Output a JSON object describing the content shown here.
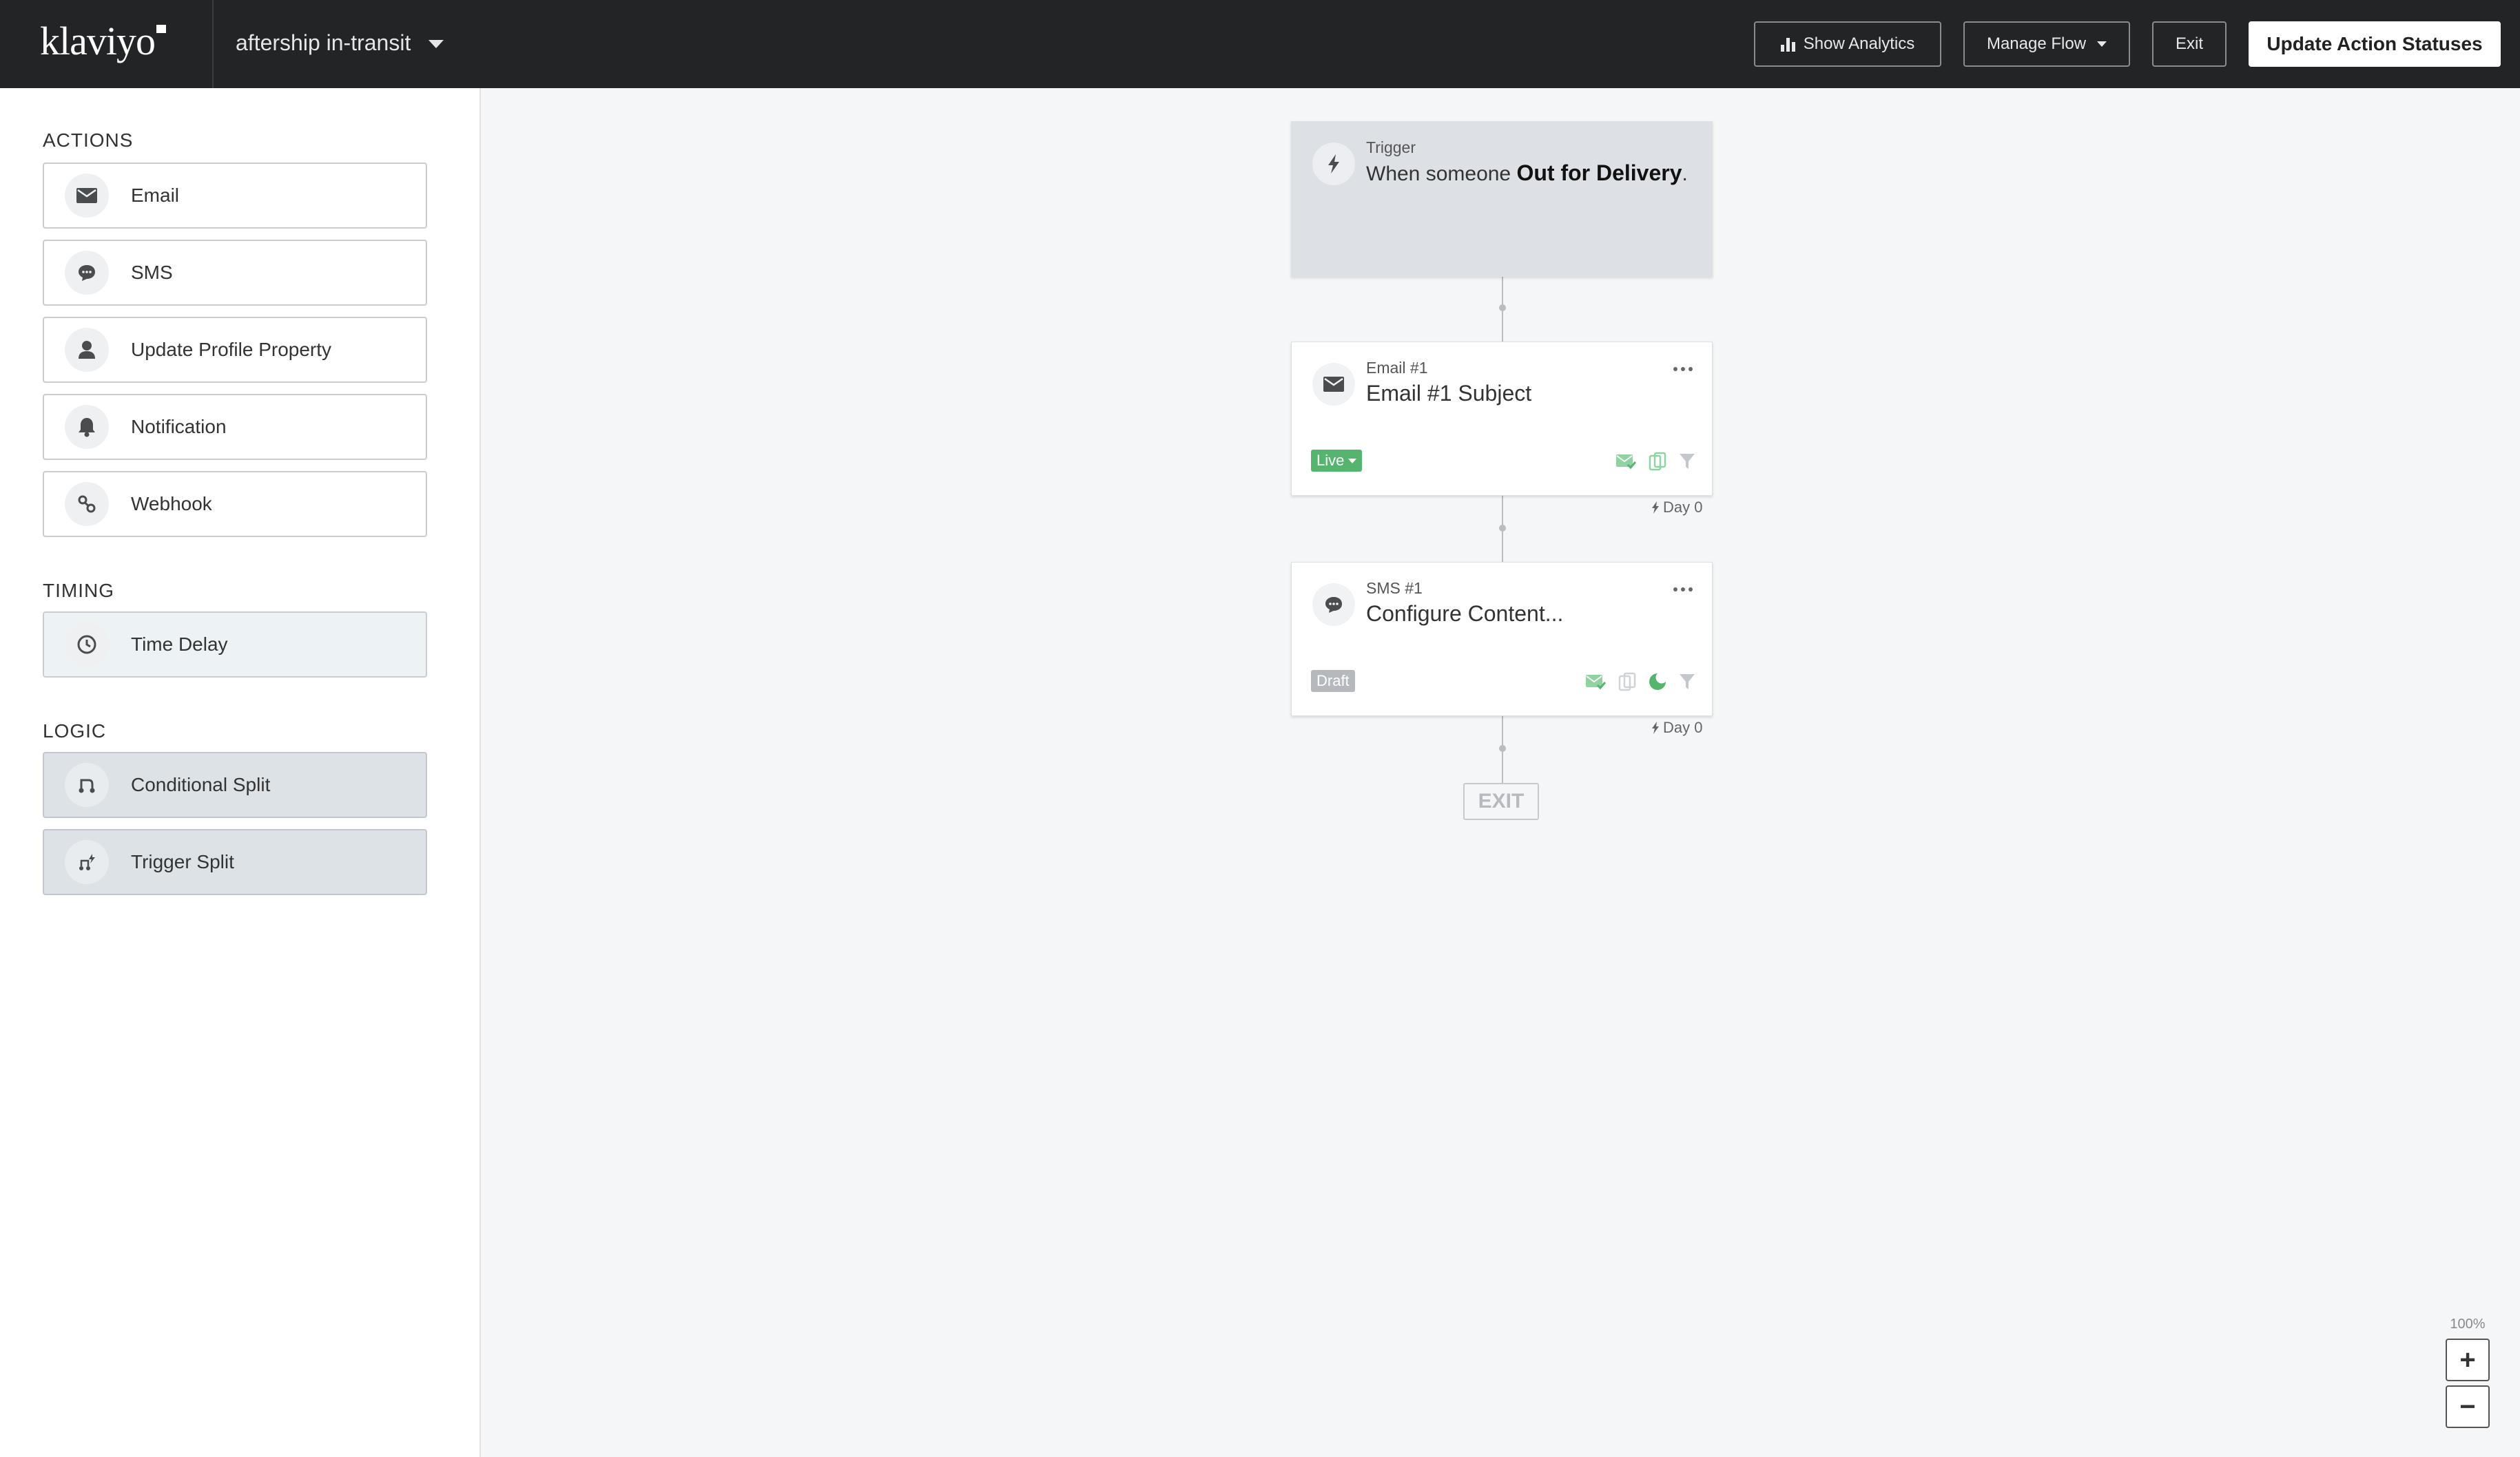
{
  "header": {
    "logo": "klaviyo",
    "flow_name": "aftership in-transit",
    "show_analytics": "Show Analytics",
    "manage_flow": "Manage Flow",
    "exit": "Exit",
    "update_statuses": "Update Action Statuses"
  },
  "sidebar": {
    "actions_heading": "ACTIONS",
    "actions": [
      {
        "label": "Email",
        "icon": "envelope-icon"
      },
      {
        "label": "SMS",
        "icon": "chat-bubble-icon"
      },
      {
        "label": "Update Profile Property",
        "icon": "person-icon"
      },
      {
        "label": "Notification",
        "icon": "bell-icon"
      },
      {
        "label": "Webhook",
        "icon": "webhook-icon"
      }
    ],
    "timing_heading": "TIMING",
    "timing": [
      {
        "label": "Time Delay",
        "icon": "clock-icon"
      }
    ],
    "logic_heading": "LOGIC",
    "logic": [
      {
        "label": "Conditional Split",
        "icon": "split-icon"
      },
      {
        "label": "Trigger Split",
        "icon": "trigger-split-icon"
      }
    ]
  },
  "flow": {
    "trigger": {
      "kind": "Trigger",
      "prefix": "When someone ",
      "event": "Out for Delivery",
      "suffix": "."
    },
    "email": {
      "kind": "Email #1",
      "title": "Email #1 Subject",
      "status": "Live",
      "delay": "Day 0"
    },
    "sms": {
      "kind": "SMS #1",
      "title": "Configure Content...",
      "status": "Draft",
      "delay": "Day 0"
    },
    "exit": "EXIT"
  },
  "zoom": {
    "level": "100%",
    "plus": "+",
    "minus": "−"
  },
  "colors": {
    "topbar": "#222425",
    "live": "#55b56f",
    "draft": "#b5b9bd",
    "canvas": "#f5f6f7"
  }
}
